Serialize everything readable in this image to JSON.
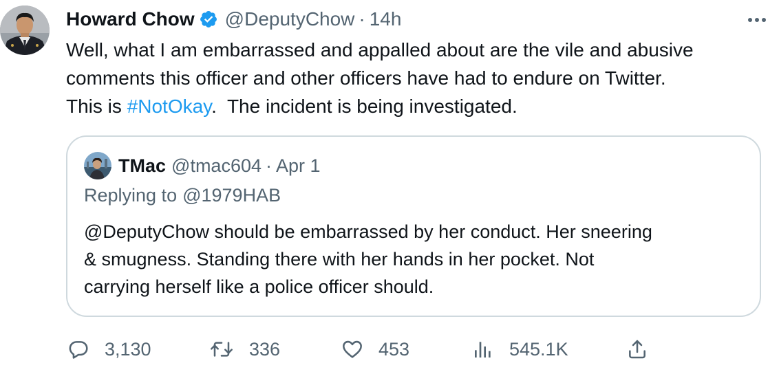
{
  "tweet": {
    "author": {
      "display_name": "Howard Chow",
      "handle": "@DeputyChow",
      "verified": true
    },
    "separator": "·",
    "time": "14h",
    "text": {
      "line1": "Well, what I am embarrassed and appalled about are the vile and abusive",
      "line2": "comments this officer and other officers have had to endure on Twitter.",
      "line3_before": "This is ",
      "hashtag": "#NotOkay",
      "line3_after": ".  The incident is being investigated."
    },
    "quoted": {
      "display_name": "TMac",
      "handle": "@tmac604",
      "separator": "·",
      "date": "Apr 1",
      "replying_label": "Replying to",
      "replying_to": "@1979HAB",
      "text": {
        "line1": "@DeputyChow should be embarrassed by her conduct. Her sneering",
        "line2": "& smugness. Standing there with her hands in her pocket. Not",
        "line3": "carrying herself like a police officer should."
      }
    },
    "actions": {
      "reply": {
        "icon": "reply-icon",
        "count": "3,130"
      },
      "retweet": {
        "icon": "retweet-icon",
        "count": "336"
      },
      "like": {
        "icon": "heart-icon",
        "count": "453"
      },
      "views": {
        "icon": "views-icon",
        "count": "545.1K"
      },
      "share": {
        "icon": "share-icon"
      }
    },
    "colors": {
      "accent": "#1d9bf0",
      "text": "#0f1419",
      "secondary": "#536471",
      "border": "#cfd9de"
    }
  }
}
